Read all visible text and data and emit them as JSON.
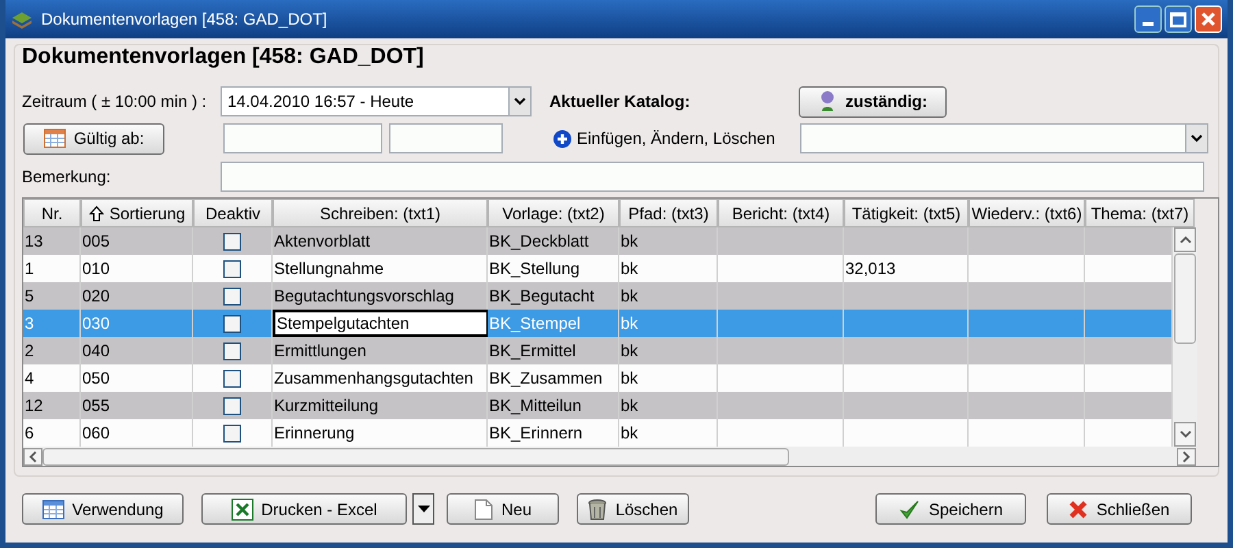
{
  "window": {
    "title": "Dokumentenvorlagen [458: GAD_DOT]"
  },
  "heading": "Dokumentenvorlagen [458: GAD_DOT]",
  "zeitraum": {
    "label": "Zeitraum ( ± 10:00 min ) :",
    "value": "14.04.2010 16:57 - Heute"
  },
  "katalog": {
    "label": "Aktueller Katalog:",
    "button": "zuständig:"
  },
  "gueltig": {
    "button": "Gültig ab:"
  },
  "aendern": {
    "label": "Einfügen, Ändern, Löschen"
  },
  "bemerkung": {
    "label": "Bemerkung:"
  },
  "table": {
    "columns": [
      {
        "label": "Nr.",
        "sorted": false
      },
      {
        "label": "Sortierung",
        "sorted": true
      },
      {
        "label": "Deaktiv",
        "sorted": false
      },
      {
        "label": "Schreiben: (txt1)",
        "sorted": false
      },
      {
        "label": "Vorlage: (txt2)",
        "sorted": false
      },
      {
        "label": "Pfad: (txt3)",
        "sorted": false
      },
      {
        "label": "Bericht: (txt4)",
        "sorted": false
      },
      {
        "label": "Tätigkeit: (txt5)",
        "sorted": false
      },
      {
        "label": "Wiederv.: (txt6)",
        "sorted": false
      },
      {
        "label": "Thema: (txt7)",
        "sorted": false
      }
    ],
    "rows": [
      {
        "nr": "13",
        "sort": "005",
        "deaktiv": false,
        "txt1": "Aktenvorblatt",
        "txt2": "BK_Deckblatt",
        "txt3": "bk",
        "txt5": "",
        "selected": false,
        "focused": false
      },
      {
        "nr": "1",
        "sort": "010",
        "deaktiv": false,
        "txt1": "Stellungnahme",
        "txt2": "BK_Stellung",
        "txt3": "bk",
        "txt5": "32,013",
        "selected": false,
        "focused": false
      },
      {
        "nr": "5",
        "sort": "020",
        "deaktiv": false,
        "txt1": "Begutachtungsvorschlag",
        "txt2": "BK_Begutacht",
        "txt3": "bk",
        "txt5": "",
        "selected": false,
        "focused": false
      },
      {
        "nr": "3",
        "sort": "030",
        "deaktiv": false,
        "txt1": "Stempelgutachten",
        "txt2": "BK_Stempel",
        "txt3": "bk",
        "txt5": "",
        "selected": true,
        "focused": true
      },
      {
        "nr": "2",
        "sort": "040",
        "deaktiv": false,
        "txt1": "Ermittlungen",
        "txt2": "BK_Ermittel",
        "txt3": "bk",
        "txt5": "",
        "selected": false,
        "focused": false
      },
      {
        "nr": "4",
        "sort": "050",
        "deaktiv": false,
        "txt1": "Zusammenhangsgutachten",
        "txt2": "BK_Zusammen",
        "txt3": "bk",
        "txt5": "",
        "selected": false,
        "focused": false
      },
      {
        "nr": "12",
        "sort": "055",
        "deaktiv": false,
        "txt1": "Kurzmitteilung",
        "txt2": "BK_Mitteilun",
        "txt3": "bk",
        "txt5": "",
        "selected": false,
        "focused": false
      },
      {
        "nr": "6",
        "sort": "060",
        "deaktiv": false,
        "txt1": "Erinnerung",
        "txt2": "BK_Erinnern",
        "txt3": "bk",
        "txt5": "",
        "selected": false,
        "focused": false
      }
    ]
  },
  "buttons": [
    {
      "label": "Verwendung",
      "kind": "table"
    },
    {
      "label": "Drucken - Excel",
      "kind": "excel"
    },
    {
      "label": "Neu",
      "kind": "new"
    },
    {
      "label": "Löschen",
      "kind": "trash"
    },
    {
      "label": "Speichern",
      "kind": "check"
    },
    {
      "label": "Schließen",
      "kind": "close"
    }
  ]
}
